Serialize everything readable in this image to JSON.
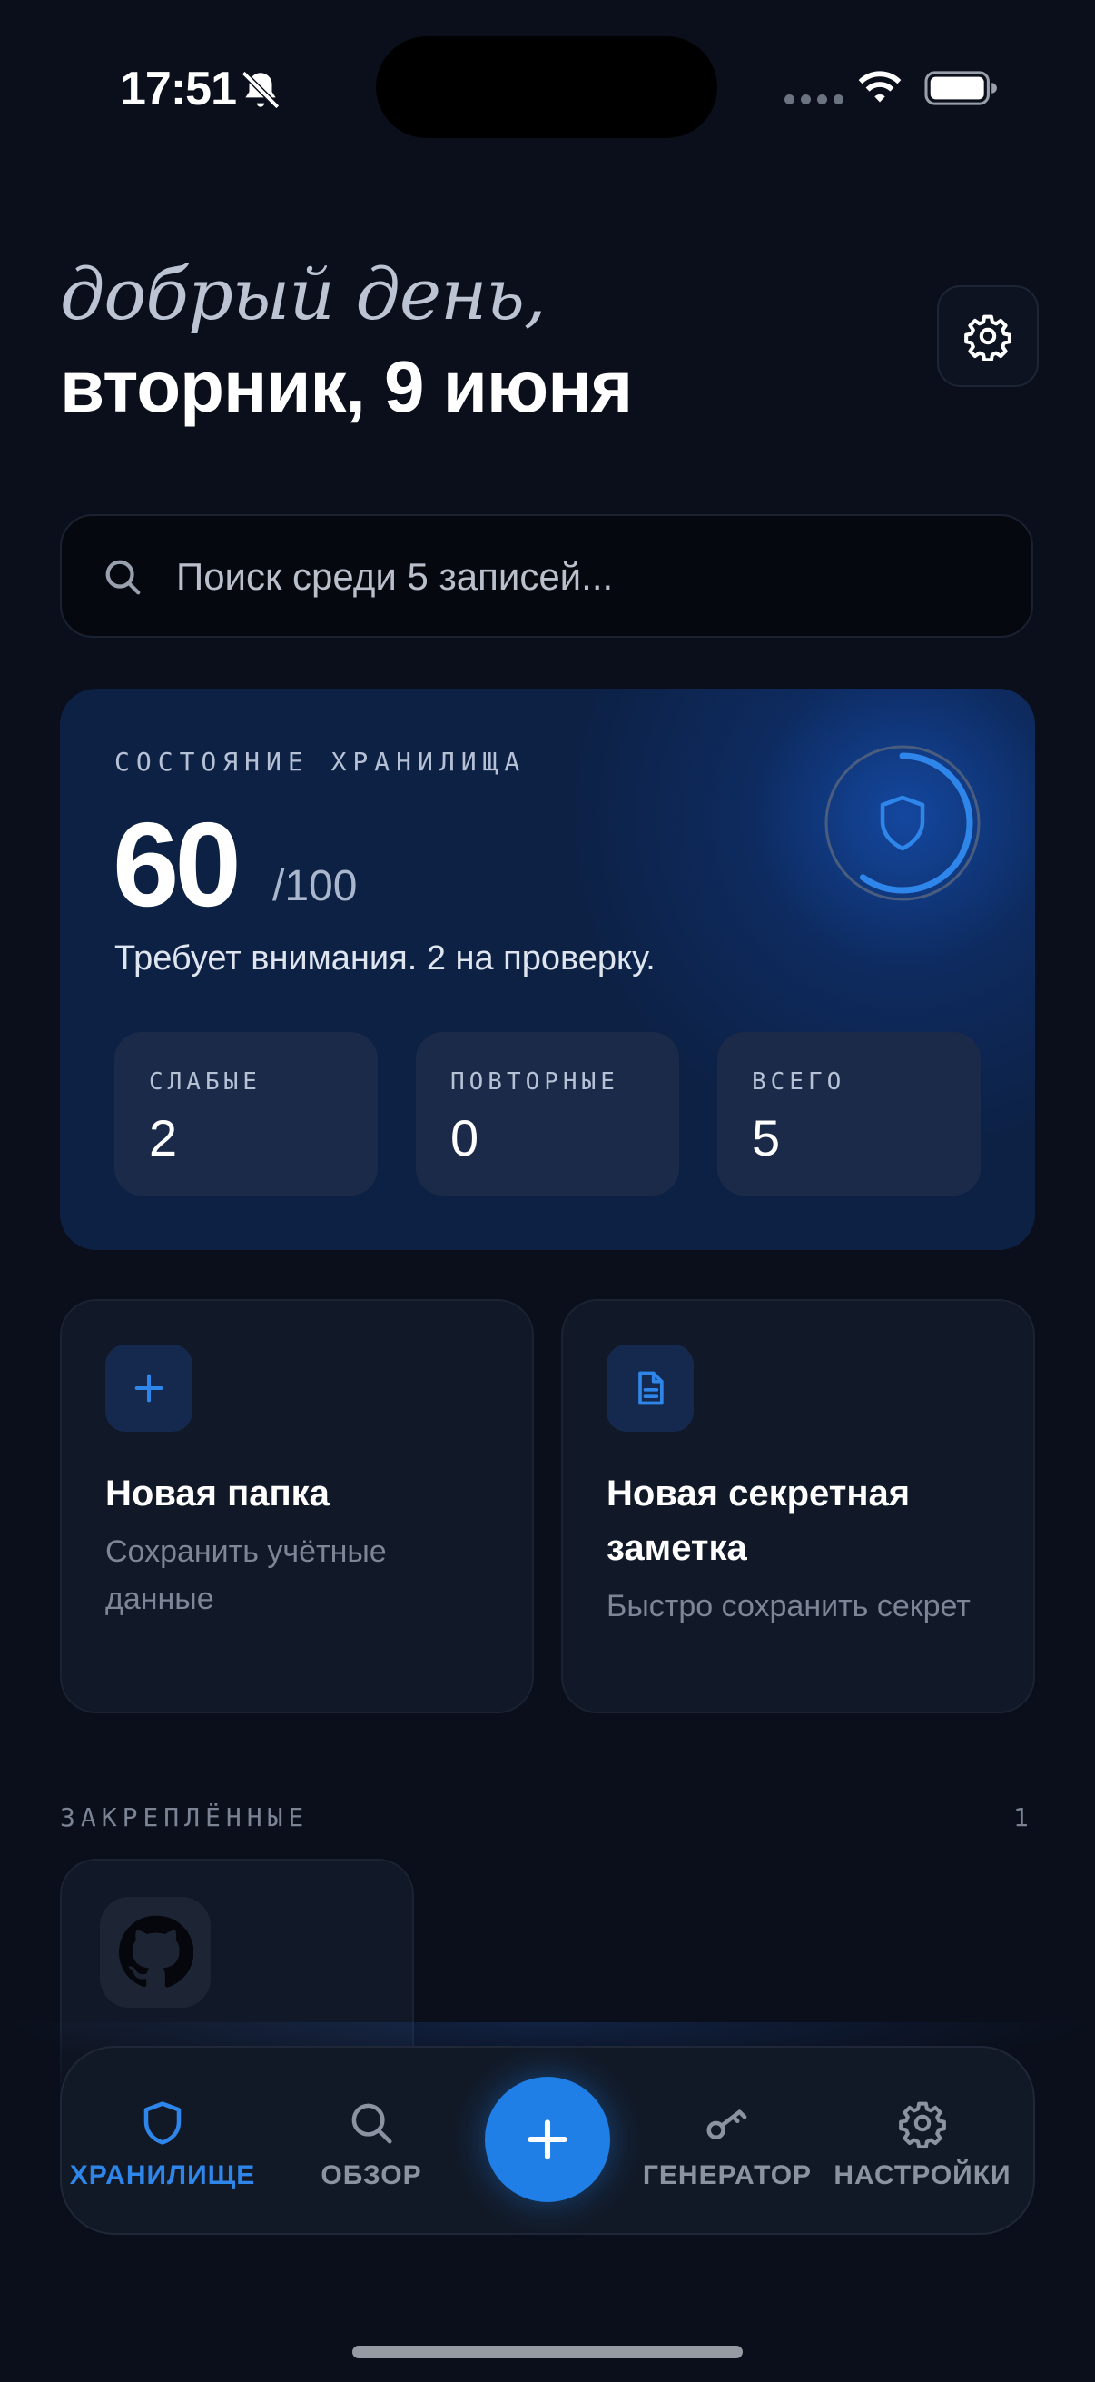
{
  "status_bar": {
    "time": "17:51"
  },
  "header": {
    "greeting": "добрый день,",
    "date": "вторник, 9 июня"
  },
  "search": {
    "placeholder": "Поиск среди 5 записей..."
  },
  "health": {
    "label": "СОСТОЯНИЕ ХРАНИЛИЩА",
    "score": "60",
    "score_max": "/100",
    "score_fraction": 0.6,
    "message": "Требует внимания. 2 на проверку.",
    "stats": [
      {
        "label": "СЛАБЫЕ",
        "value": "2"
      },
      {
        "label": "ПОВТОРНЫЕ",
        "value": "0"
      },
      {
        "label": "ВСЕГО",
        "value": "5"
      }
    ]
  },
  "actions": [
    {
      "title": "Новая папка",
      "subtitle": "Сохранить учётные данные",
      "icon": "plus-icon"
    },
    {
      "title": "Новая секретная заметка",
      "subtitle": "Быстро сохранить секрет",
      "icon": "document-icon"
    }
  ],
  "pinned": {
    "label": "ЗАКРЕПЛЁННЫЕ",
    "count": "1",
    "items": [
      {
        "icon": "github-icon"
      }
    ]
  },
  "tabbar": {
    "tabs": [
      {
        "label": "ХРАНИЛИЩЕ",
        "icon": "shield-icon",
        "active": true
      },
      {
        "label": "ОБЗОР",
        "icon": "search-icon",
        "active": false
      },
      {
        "label": "ГЕНЕРАТОР",
        "icon": "key-icon",
        "active": false
      },
      {
        "label": "НАСТРОЙКИ",
        "icon": "gear-icon",
        "active": false
      }
    ],
    "fab_icon": "plus-icon"
  },
  "colors": {
    "background": "#0a0f1b",
    "accent": "#1f7fe6",
    "card": "#111827",
    "health_card": "#0d2145"
  }
}
